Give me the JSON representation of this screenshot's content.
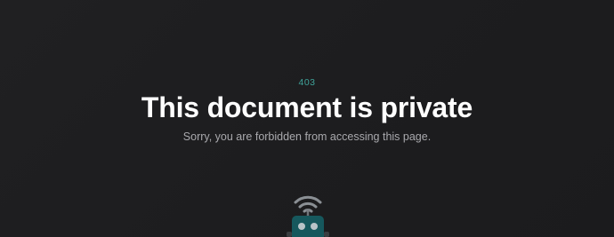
{
  "error": {
    "code": "403",
    "title": "This document is private",
    "message": "Sorry, you are forbidden from accessing this page."
  },
  "illustration": {
    "icon": "robot-with-wifi-signal",
    "colors": {
      "body": "#16585d",
      "eyes": "#b9c4c8",
      "signal": "#8a8f94",
      "antenna": "#6f7378"
    }
  },
  "colors": {
    "background": "#1e1e20",
    "accent": "#3fa39a",
    "title": "#ffffff",
    "subtitle": "#a9a9ad"
  }
}
